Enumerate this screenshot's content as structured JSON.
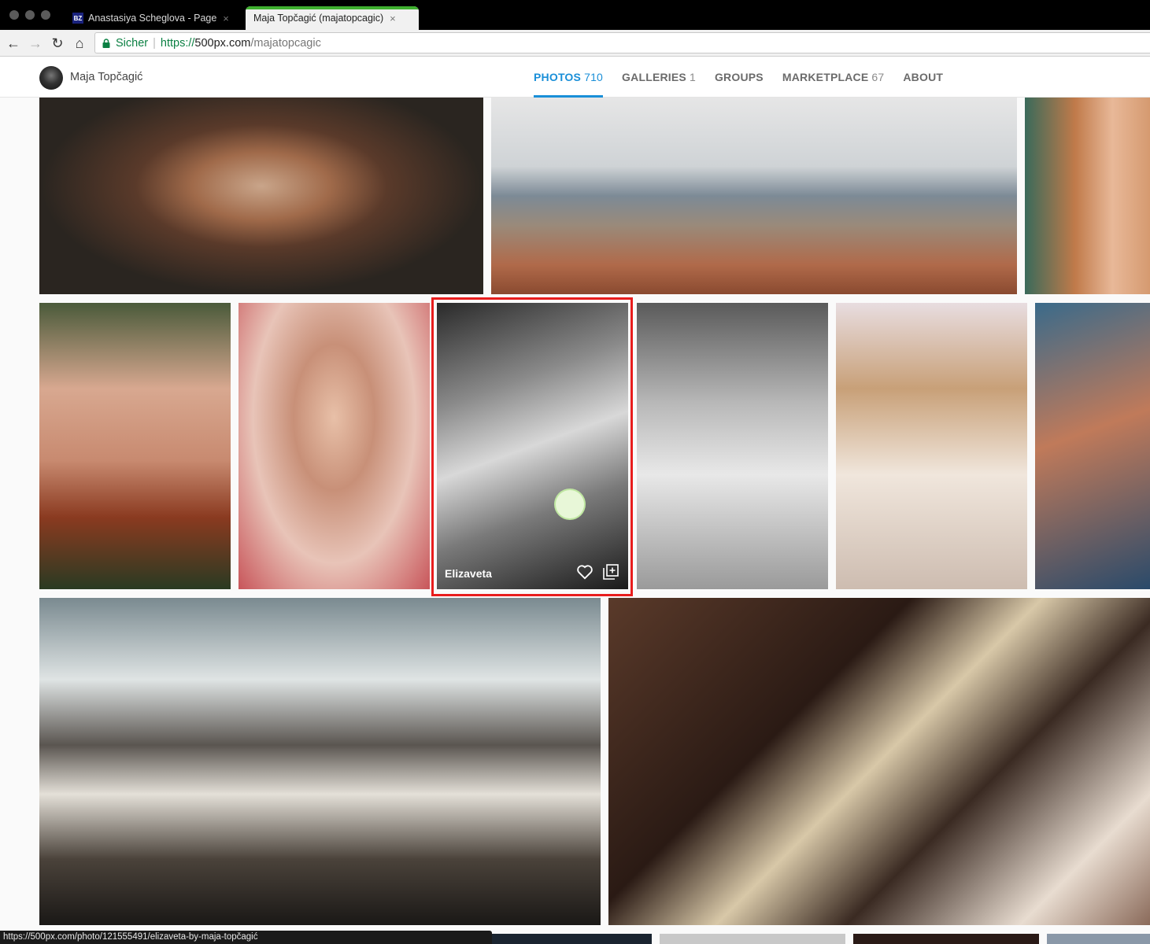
{
  "browser": {
    "tabs": [
      {
        "favicon": "BZ",
        "label": "Anastasiya Scheglova - Page",
        "active": false
      },
      {
        "label": "Maja Topčagić (majatopcagic)",
        "active": true
      }
    ],
    "address": {
      "secure_label": "Sicher",
      "scheme": "https://",
      "host": "500px.com",
      "path": "/majatopcagic"
    },
    "status_url": "https://500px.com/photo/121555491/elizaveta-by-maja-topčagić"
  },
  "profile": {
    "name": "Maja Topčagić",
    "nav": [
      {
        "label": "PHOTOS",
        "count": "710",
        "active": true
      },
      {
        "label": "GALLERIES",
        "count": "1",
        "active": false
      },
      {
        "label": "GROUPS",
        "count": "",
        "active": false
      },
      {
        "label": "MARKETPLACE",
        "count": "67",
        "active": false
      },
      {
        "label": "ABOUT",
        "count": "",
        "active": false
      }
    ]
  },
  "hovered_photo": {
    "title": "Elizaveta"
  },
  "colors": {
    "accent": "#1a8fd8",
    "highlight": "#e81d1d",
    "secure": "#0b8043"
  },
  "icons": [
    "back-arrow-icon",
    "forward-arrow-icon",
    "reload-icon",
    "home-icon",
    "lock-icon",
    "heart-icon",
    "add-to-gallery-icon",
    "cursor-icon"
  ]
}
